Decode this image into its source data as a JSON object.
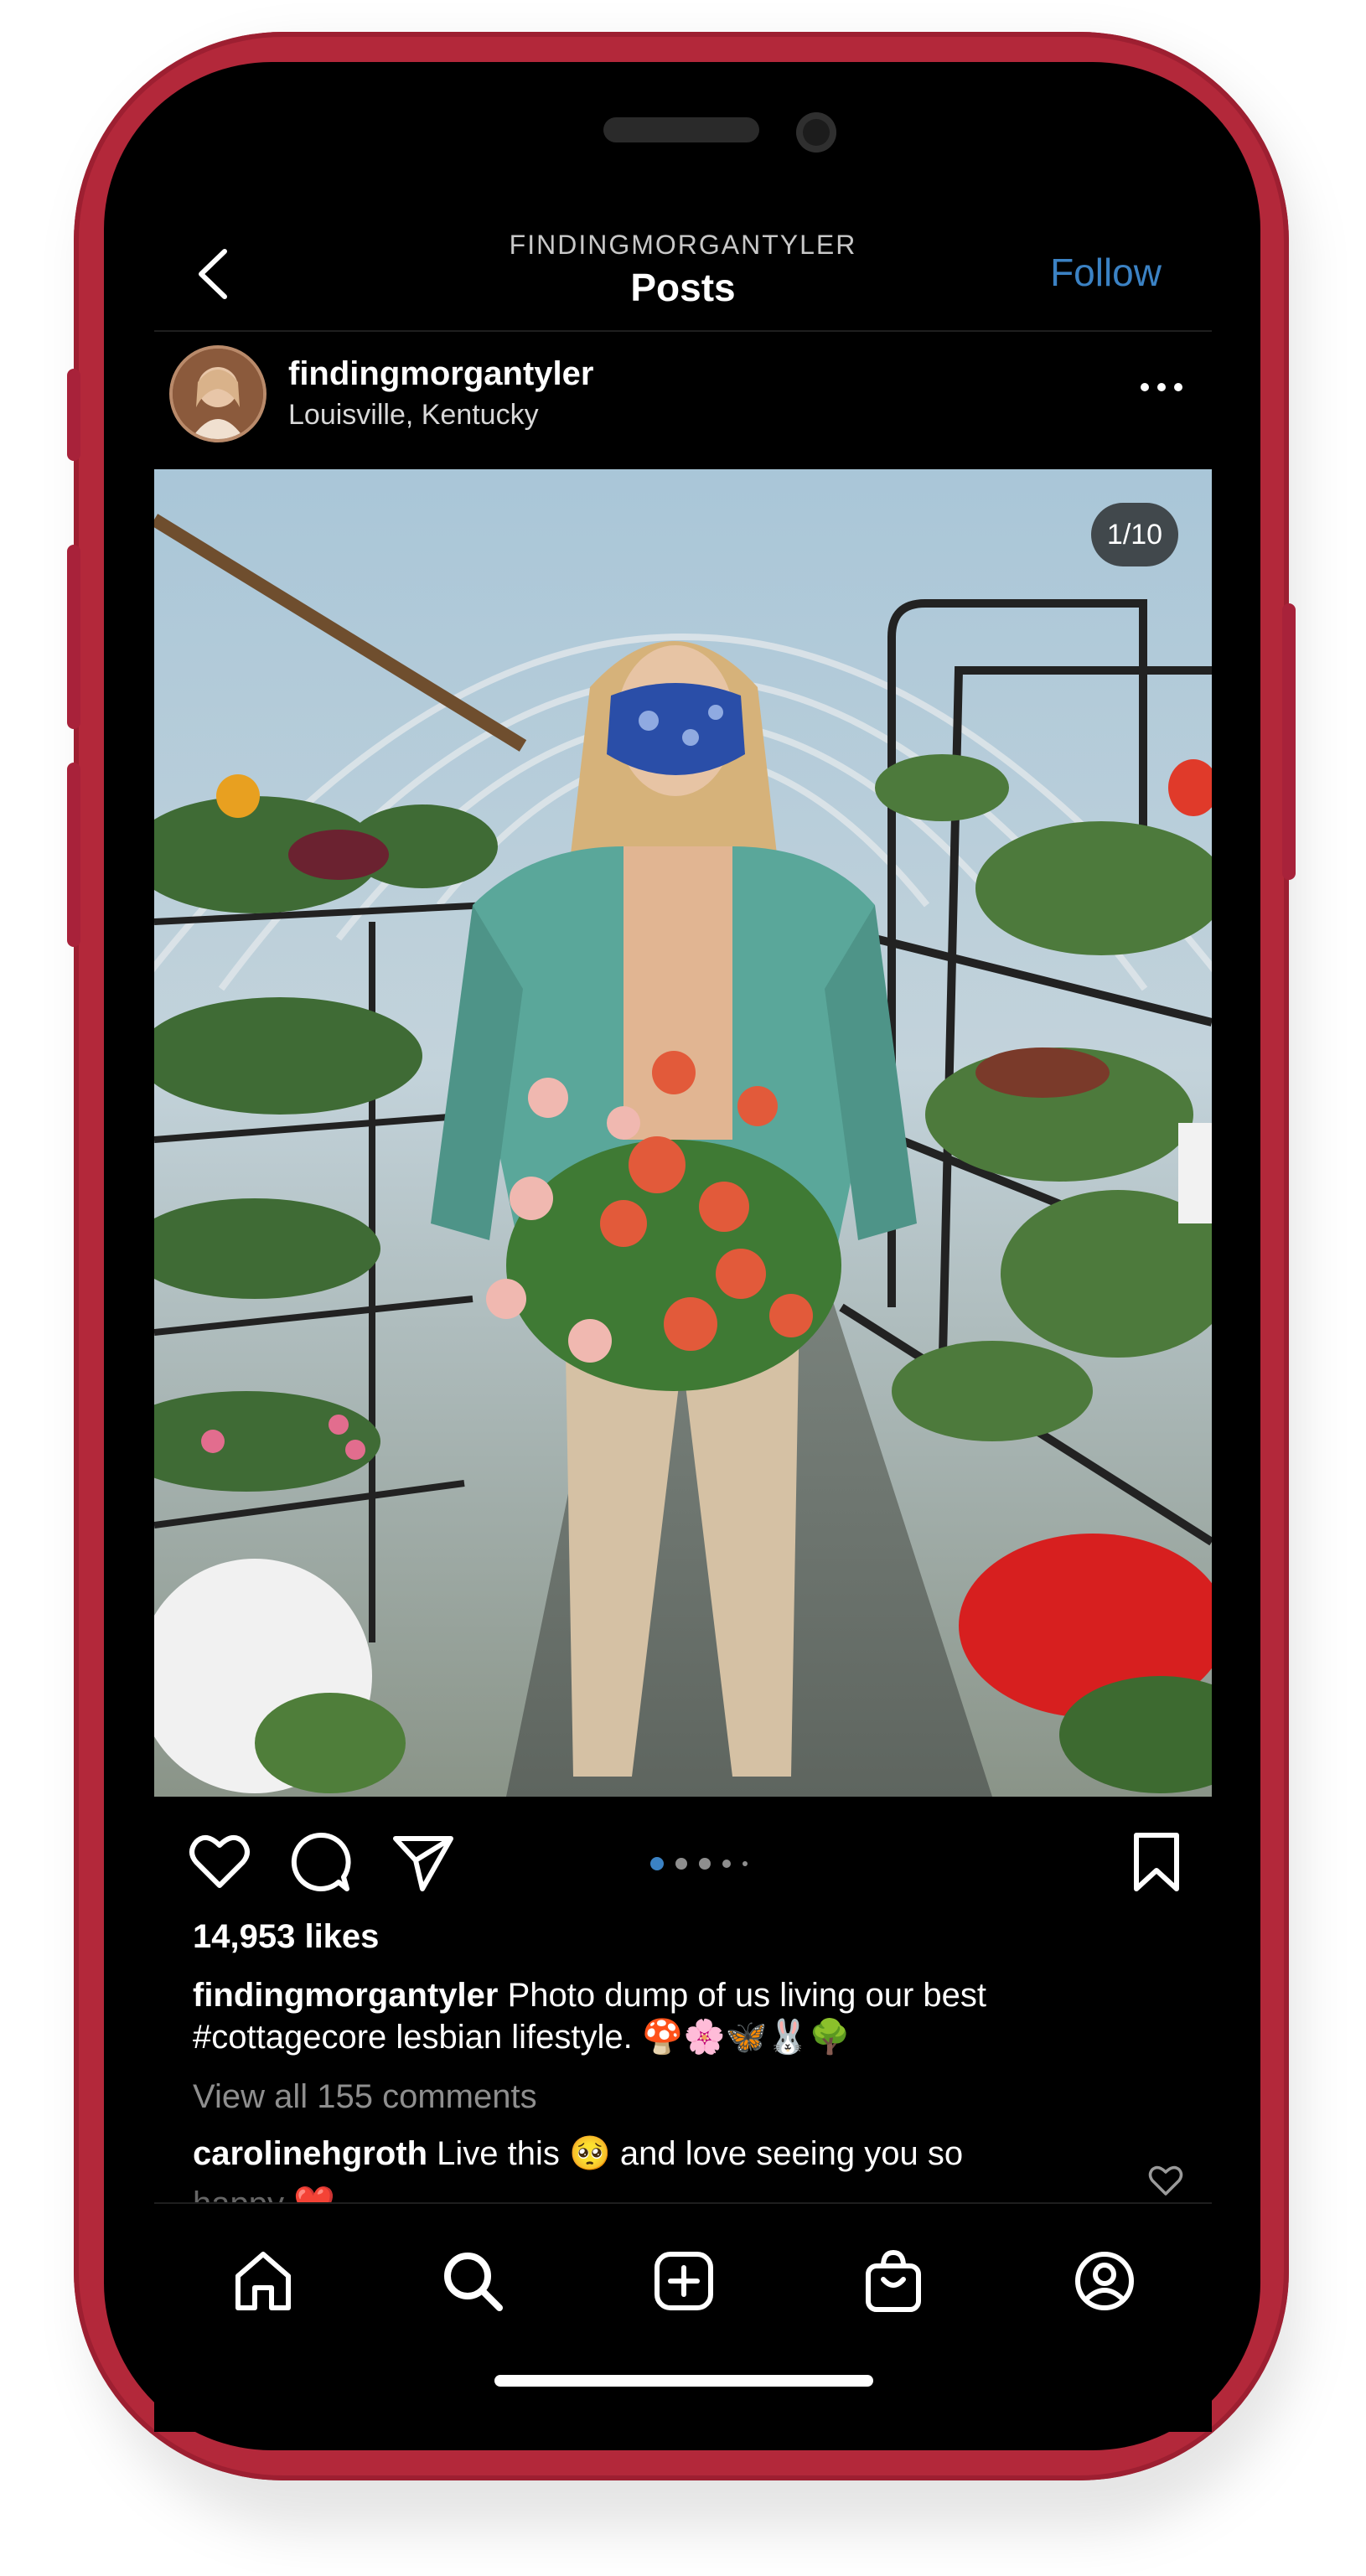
{
  "header": {
    "username": "FINDINGMORGANTYLER",
    "title": "Posts",
    "follow_label": "Follow"
  },
  "post": {
    "username": "findingmorgantyler",
    "location": "Louisville, Kentucky",
    "image_counter": "1/10",
    "carousel": {
      "total_dots": 5,
      "active_index": 0
    },
    "likes": "14,953 likes",
    "caption_user": "findingmorgantyler",
    "caption_text": "Photo dump of us living our best #cottagecore lesbian lifestyle. 🍄🌸🦋🐰🌳",
    "view_comments": "View all 155 comments",
    "comment_user": "carolinehgroth",
    "comment_text": "Live this 🥺 and love seeing you so",
    "comment_overflow": "happy ❤️"
  },
  "tabs": [
    {
      "name": "home",
      "icon": "home-icon"
    },
    {
      "name": "search",
      "icon": "search-icon"
    },
    {
      "name": "create",
      "icon": "plus-square-icon"
    },
    {
      "name": "shop",
      "icon": "shopping-bag-icon"
    },
    {
      "name": "profile",
      "icon": "profile-icon"
    }
  ],
  "colors": {
    "frame": "#b3283a",
    "follow": "#3b82c4",
    "active_dot": "#3b82c4",
    "inactive_dot": "#8e8e8e"
  }
}
